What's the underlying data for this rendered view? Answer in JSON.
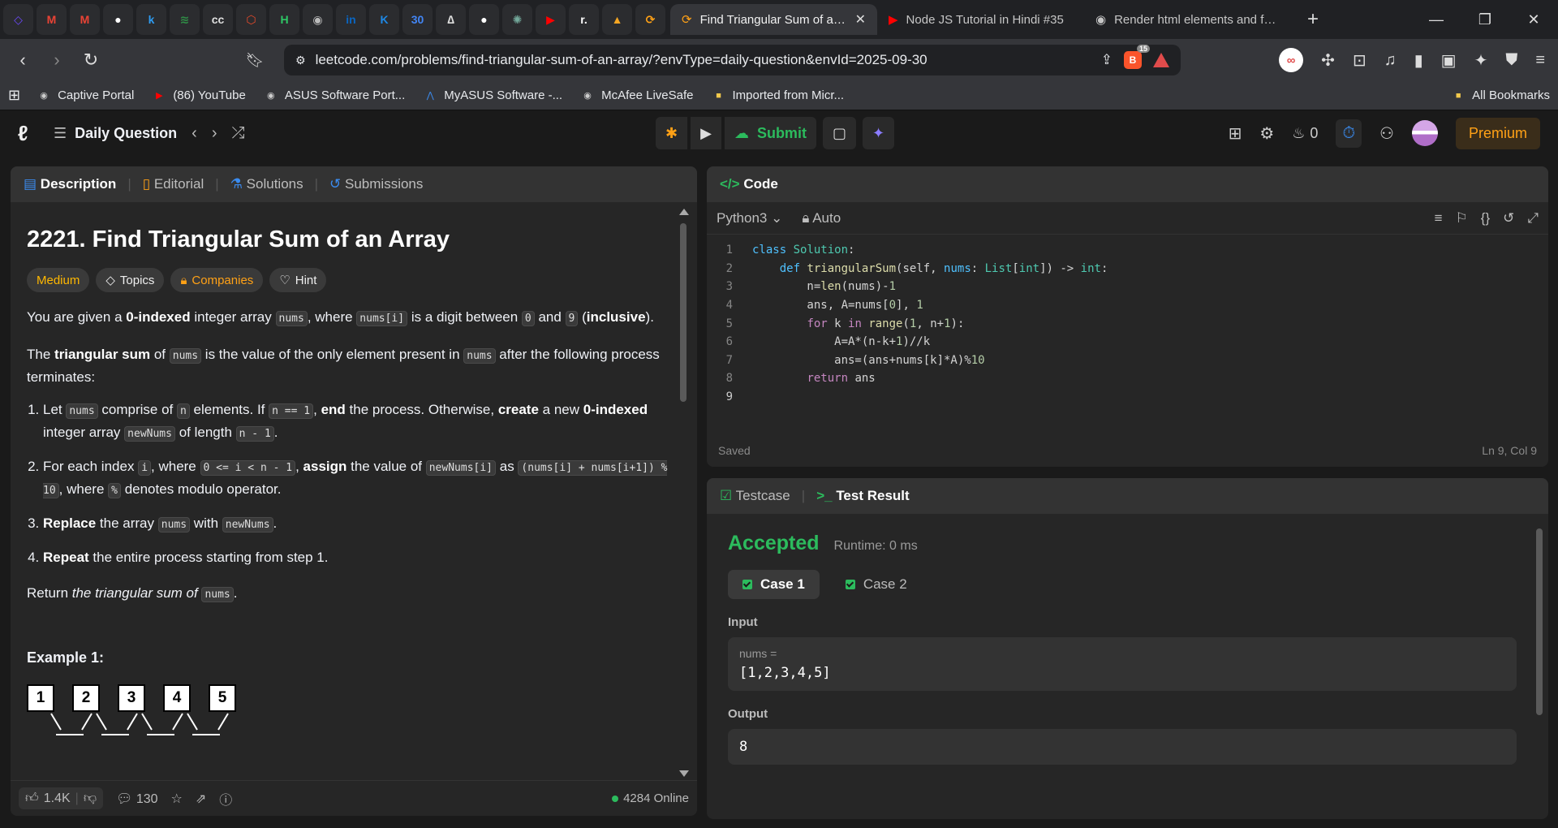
{
  "browser": {
    "pinned_tabs": [
      {
        "icon": "proton-icon",
        "glyph": "◇",
        "color": "#6d4aff"
      },
      {
        "icon": "gmail-icon",
        "glyph": "M",
        "color": "#ea4335"
      },
      {
        "icon": "gmail-icon",
        "glyph": "M",
        "color": "#ea4335"
      },
      {
        "icon": "github-icon",
        "glyph": "●",
        "color": "#ffffff"
      },
      {
        "icon": "k-icon",
        "glyph": "k",
        "color": "#2e9bf0"
      },
      {
        "icon": "ge-icon",
        "glyph": "≋",
        "color": "#2f8d46"
      },
      {
        "icon": "cc-icon",
        "glyph": "cc",
        "color": "#e0e0e0"
      },
      {
        "icon": "hex-icon",
        "glyph": "⬡",
        "color": "#e84a2a"
      },
      {
        "icon": "hackerrank-icon",
        "glyph": "H",
        "color": "#2ec866"
      },
      {
        "icon": "globe-icon",
        "glyph": "◉",
        "color": "#bbbbbb"
      },
      {
        "icon": "linkedin-icon",
        "glyph": "in",
        "color": "#0a66c2"
      },
      {
        "icon": "codeforces-icon",
        "glyph": "K",
        "color": "#1e88e5"
      },
      {
        "icon": "calendar-icon",
        "glyph": "30",
        "color": "#4285f4"
      },
      {
        "icon": "codechef-icon",
        "glyph": "∆",
        "color": "#dddddd"
      },
      {
        "icon": "github-icon",
        "glyph": "●",
        "color": "#ffffff"
      },
      {
        "icon": "chatgpt-icon",
        "glyph": "✺",
        "color": "#74aa9c"
      },
      {
        "icon": "youtube-icon",
        "glyph": "▶",
        "color": "#ff0000"
      },
      {
        "icon": "r-icon",
        "glyph": "r.",
        "color": "#ffffff"
      },
      {
        "icon": "rocket-icon",
        "glyph": "▲",
        "color": "#f5a623"
      },
      {
        "icon": "leetcode-icon",
        "glyph": "⟳",
        "color": "#ffa116"
      }
    ],
    "tabs": [
      {
        "title": "Find Triangular Sum of an Array",
        "active": true,
        "icon": "leetcode-icon"
      },
      {
        "title": "Node JS Tutorial in Hindi #35",
        "active": false,
        "icon": "youtube-icon"
      },
      {
        "title": "Render html elements and forms",
        "active": false,
        "icon": "globe-icon"
      }
    ],
    "url": "leetcode.com/problems/find-triangular-sum-of-an-array/?envType=daily-question&envId=2025-09-30",
    "brave_badge": "15",
    "bookmarks": [
      {
        "label": "Captive Portal",
        "icon": "globe-icon",
        "color": "#cccccc"
      },
      {
        "label": "(86) YouTube",
        "icon": "youtube-icon",
        "color": "#ff0000"
      },
      {
        "label": "ASUS Software Port...",
        "icon": "globe-icon",
        "color": "#cccccc"
      },
      {
        "label": "MyASUS Software -...",
        "icon": "asus-icon",
        "color": "#3b8cf0"
      },
      {
        "label": "McAfee LiveSafe",
        "icon": "globe-icon",
        "color": "#cccccc"
      },
      {
        "label": "Imported from Micr...",
        "icon": "folder-icon",
        "color": "#f2c94c"
      }
    ],
    "all_bookmarks": "All Bookmarks"
  },
  "lc_header": {
    "daily": "Daily Question",
    "submit": "Submit",
    "streak": "0",
    "premium": "Premium"
  },
  "left_panel": {
    "tabs": [
      "Description",
      "Editorial",
      "Solutions",
      "Submissions"
    ],
    "title": "2221. Find Triangular Sum of an Array",
    "chips": [
      "Medium",
      "Topics",
      "Companies",
      "Hint"
    ],
    "example_heading": "Example 1:",
    "example_boxes": [
      "1",
      "2",
      "3",
      "4",
      "5"
    ],
    "likes": "1.4K",
    "comments": "130",
    "online": "4284 Online"
  },
  "code_panel": {
    "title": "Code",
    "language": "Python3",
    "mode": "Auto",
    "status_saved": "Saved",
    "cursor": "Ln 9, Col 9",
    "line_numbers": [
      "1",
      "2",
      "3",
      "4",
      "5",
      "6",
      "7",
      "8",
      "9"
    ]
  },
  "test_panel": {
    "tabs": [
      "Testcase",
      "Test Result"
    ],
    "verdict": "Accepted",
    "runtime": "Runtime: 0 ms",
    "cases": [
      "Case 1",
      "Case 2"
    ],
    "input_label": "Input",
    "input_name": "nums =",
    "input_value": "[1,2,3,4,5]",
    "output_label": "Output",
    "output_value": "8",
    "accent": "#2cbb5d"
  }
}
